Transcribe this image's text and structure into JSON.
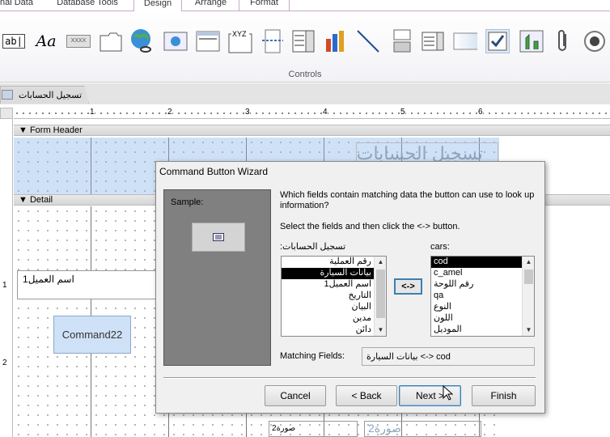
{
  "ribbon": {
    "tabs": [
      {
        "label": "nal Data"
      },
      {
        "label": "Database Tools"
      },
      {
        "label": "Design"
      },
      {
        "label": "Arrange"
      },
      {
        "label": "Format"
      }
    ],
    "group_label": "Controls",
    "textbox_glyph": "ab|",
    "label_glyph": "Aa",
    "button_glyph": "XXXX",
    "optgroup_glyph": "XYZ"
  },
  "document": {
    "tab_label": "تسجيل الحسابات",
    "form_header_label": "Form Header",
    "detail_label": "Detail",
    "ruler_numbers": [
      "1",
      "2",
      "3",
      "4",
      "5",
      "6"
    ],
    "vruler_numbers": [
      "1",
      "2"
    ],
    "header_title": "تسجيل الحسابات",
    "field_label": "اسم العميل1",
    "command_label": "Command22",
    "image_label_1": "صورة2",
    "image_label_2": "صورة2"
  },
  "wizard": {
    "title": "Command Button Wizard",
    "sample_label": "Sample:",
    "question": "Which fields contain matching data the button can use to look up information?",
    "instruction": "Select the fields and then click the <-> button.",
    "left_list_label": "تسجيل الحسابات:",
    "left_items": [
      "رقم العملية",
      "بيانات السيارة",
      "اسم العميل1",
      "التاريخ",
      "البيان",
      "مدين",
      "دائن"
    ],
    "left_selected_index": 1,
    "right_list_label": "cars:",
    "right_items": [
      "cod",
      "c_amel",
      "رقم اللوحة",
      "qa",
      "النوع",
      "اللون",
      "الموديل"
    ],
    "right_selected_index": 0,
    "swap_button": "<->",
    "matching_label": "Matching Fields:",
    "matching_value": "بيانات السيارة <-> cod",
    "buttons": {
      "cancel": "Cancel",
      "back": "< Back",
      "next": "Next >",
      "finish": "Finish"
    }
  }
}
